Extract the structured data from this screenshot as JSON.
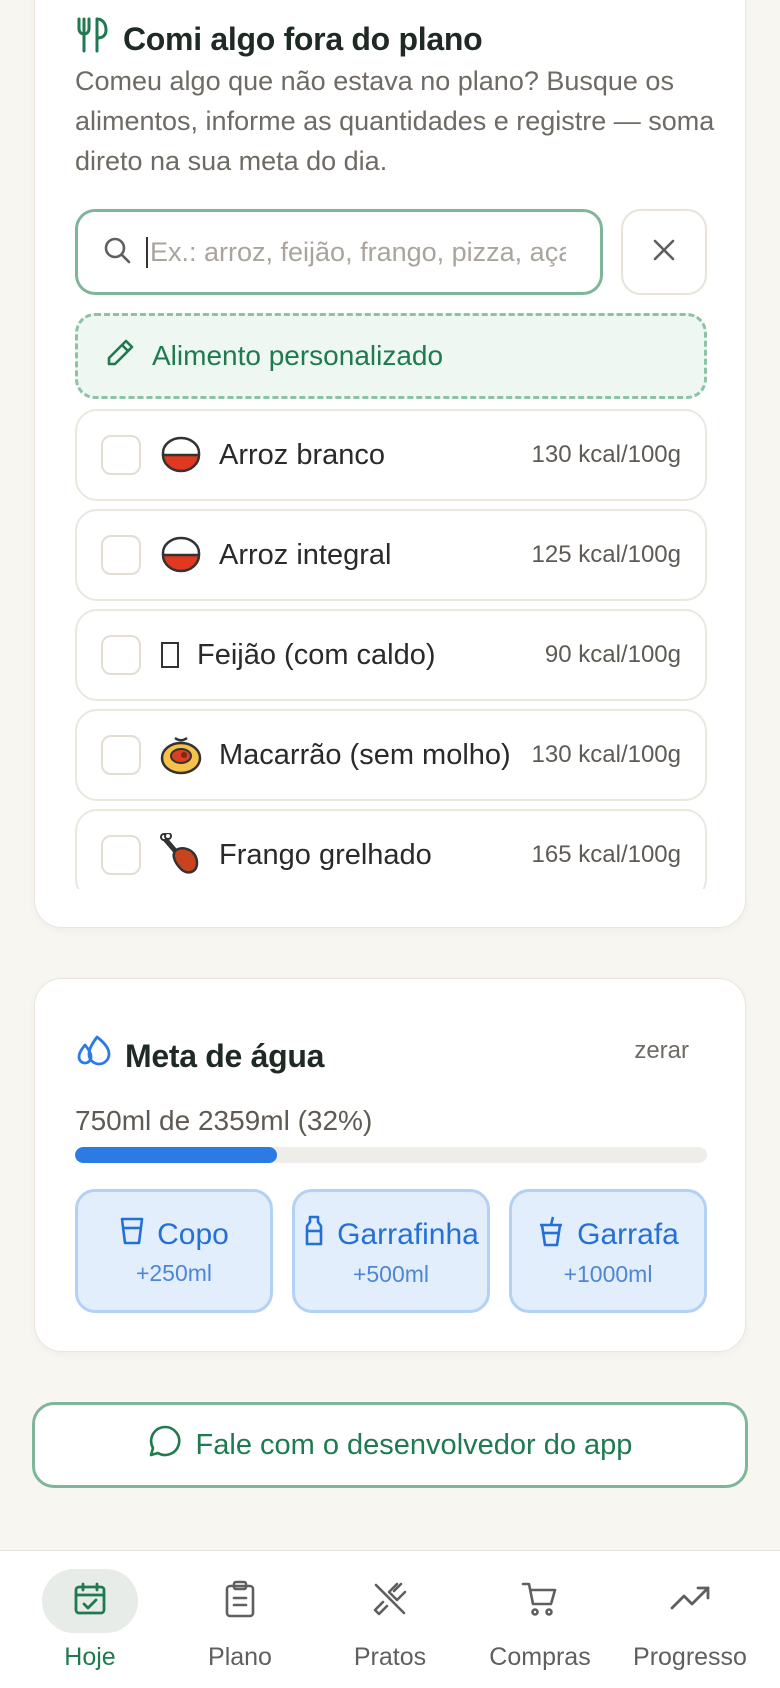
{
  "meal_card": {
    "title": "Comi algo fora do plano",
    "description": "Comeu algo que não estava no plano? Busque os alimentos, informe as quantidades e registre — soma direto na sua meta do dia.",
    "search_placeholder": "Ex.: arroz, feijão, frango, pizza, açaí...",
    "custom_food_label": "Alimento personalizado",
    "foods": [
      {
        "name": "Arroz branco",
        "kcal": "130 kcal/100g",
        "icon": "rice-bowl-icon"
      },
      {
        "name": "Arroz integral",
        "kcal": "125 kcal/100g",
        "icon": "rice-bowl-icon"
      },
      {
        "name": "Feijão (com caldo)",
        "kcal": "90 kcal/100g",
        "icon": "missing-glyph-icon"
      },
      {
        "name": "Macarrão (sem molho)",
        "kcal": "130 kcal/100g",
        "icon": "pasta-icon"
      },
      {
        "name": "Frango grelhado",
        "kcal": "165 kcal/100g",
        "icon": "chicken-leg-icon"
      }
    ]
  },
  "water_card": {
    "title": "Meta de água",
    "reset_label": "zerar",
    "status": "750ml de 2359ml (32%)",
    "progress_fraction": 0.32,
    "buttons": [
      {
        "label": "Copo",
        "amount": "+250ml",
        "icon": "cup-icon"
      },
      {
        "label": "Garrafinha",
        "amount": "+500ml",
        "icon": "small-bottle-icon"
      },
      {
        "label": "Garrafa",
        "amount": "+1000ml",
        "icon": "bottle-icon"
      }
    ]
  },
  "feedback_label": "Fale com o desenvolvedor do app",
  "nav": [
    {
      "label": "Hoje",
      "icon": "calendar-check-icon",
      "active": true
    },
    {
      "label": "Plano",
      "icon": "clipboard-icon",
      "active": false
    },
    {
      "label": "Pratos",
      "icon": "utensils-crossed-icon",
      "active": false
    },
    {
      "label": "Compras",
      "icon": "cart-icon",
      "active": false
    },
    {
      "label": "Progresso",
      "icon": "trending-up-icon",
      "active": false
    }
  ],
  "colors": {
    "accent_green": "#1f7a4f",
    "water_blue": "#2c7be5",
    "background": "#f8f6f1"
  }
}
